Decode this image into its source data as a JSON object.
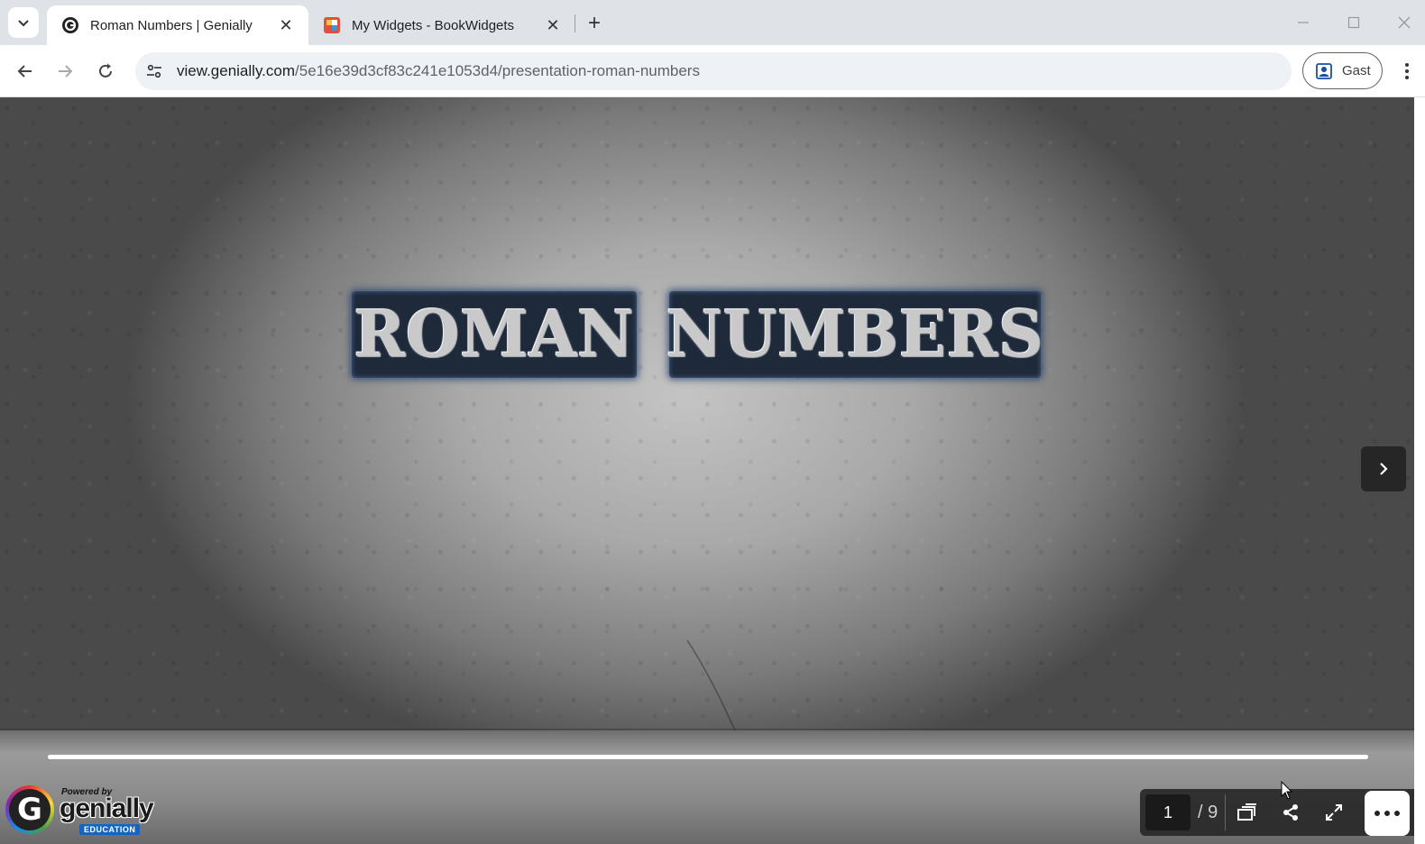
{
  "browser": {
    "tabs": [
      {
        "title": "Roman Numbers | Genially",
        "active": true
      },
      {
        "title": "My Widgets - BookWidgets",
        "active": false
      }
    ],
    "url_host": "view.genially.com",
    "url_path": "/5e16e39d3cf83c241e1053d4/presentation-roman-numbers",
    "profile_label": "Gast"
  },
  "presentation": {
    "title_words": [
      "ROMAN",
      "NUMBERS"
    ],
    "current_page": "1",
    "total_pages": "/ 9",
    "progress_fraction": 1.0,
    "logo": {
      "powered_by": "Powered by",
      "brand": "genially",
      "edition": "EDUCATION"
    }
  },
  "icons": [
    "tab-search-icon",
    "genially-favicon",
    "bookwidgets-favicon",
    "close-icon",
    "plus-icon",
    "back-arrow-icon",
    "forward-arrow-icon",
    "reload-icon",
    "site-info-icon",
    "profile-icon",
    "kebab-menu-icon",
    "chevron-right-icon",
    "pages-icon",
    "share-icon",
    "fullscreen-icon",
    "more-dots-icon",
    "cursor-icon"
  ],
  "colors": {
    "tabstrip": "#dfe3e8",
    "omnibox": "#eef1f5",
    "controls_bg": "#282828",
    "progress": "#ffffff"
  }
}
